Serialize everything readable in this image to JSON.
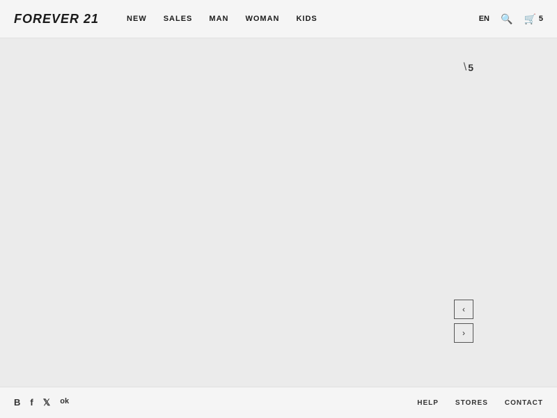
{
  "header": {
    "logo": "FOREVER 21",
    "nav": {
      "items": [
        {
          "label": "NEW",
          "id": "new"
        },
        {
          "label": "SALES",
          "id": "sales"
        },
        {
          "label": "MAN",
          "id": "man"
        },
        {
          "label": "WOMAN",
          "id": "woman"
        },
        {
          "label": "KIDS",
          "id": "kids"
        }
      ]
    },
    "lang": "EN",
    "cart_count": "5"
  },
  "discount": {
    "symbol": "\\",
    "value": "5"
  },
  "carousel": {
    "prev_label": "‹",
    "next_label": "›"
  },
  "footer": {
    "social": [
      {
        "label": "B",
        "name": "blog-icon"
      },
      {
        "label": "f",
        "name": "facebook-icon"
      },
      {
        "label": "𝕏",
        "name": "twitter-icon"
      },
      {
        "label": "ok",
        "name": "odnoklassniki-icon"
      }
    ],
    "links": [
      {
        "label": "HELP",
        "id": "help"
      },
      {
        "label": "STORES",
        "id": "stores"
      },
      {
        "label": "CONTACT",
        "id": "contact"
      }
    ]
  }
}
